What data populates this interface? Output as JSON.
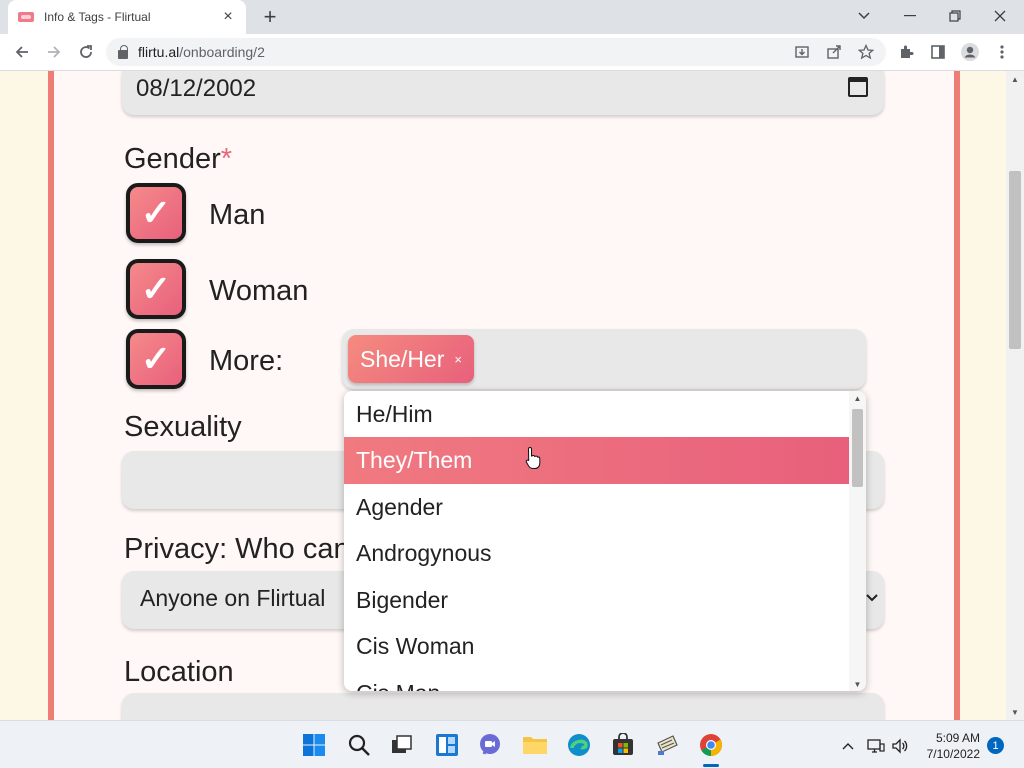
{
  "browser": {
    "tab_title": "Info & Tags - Flirtual",
    "url_domain": "flirtu.al",
    "url_path": "/onboarding/2",
    "new_tab_label": "+",
    "tab_close_label": "×"
  },
  "form": {
    "birthday_value": "08/12/2002",
    "gender_label": "Gender",
    "required_marker": "*",
    "gender_options": [
      {
        "label": "Man",
        "checked": true
      },
      {
        "label": "Woman",
        "checked": true
      },
      {
        "label": "More:",
        "checked": true
      }
    ],
    "checkmark": "✓",
    "selected_tags": [
      {
        "label": "She/Her",
        "remove": "×"
      }
    ],
    "sexuality_label": "Sexuality",
    "privacy_label": "Privacy: Who can see",
    "privacy_value": "Anyone on Flirtual",
    "location_label": "Location"
  },
  "dropdown": {
    "options": [
      "He/Him",
      "They/Them",
      "Agender",
      "Androgynous",
      "Bigender",
      "Cis Woman",
      "Cis Man"
    ],
    "highlighted": "They/Them"
  },
  "taskbar": {
    "time": "5:09 AM",
    "date": "7/10/2022",
    "notification_count": "1"
  },
  "colors": {
    "accent_start": "#f58a8a",
    "accent_end": "#e8607c",
    "card_border": "#ef7d77",
    "required": "#e5677a"
  }
}
